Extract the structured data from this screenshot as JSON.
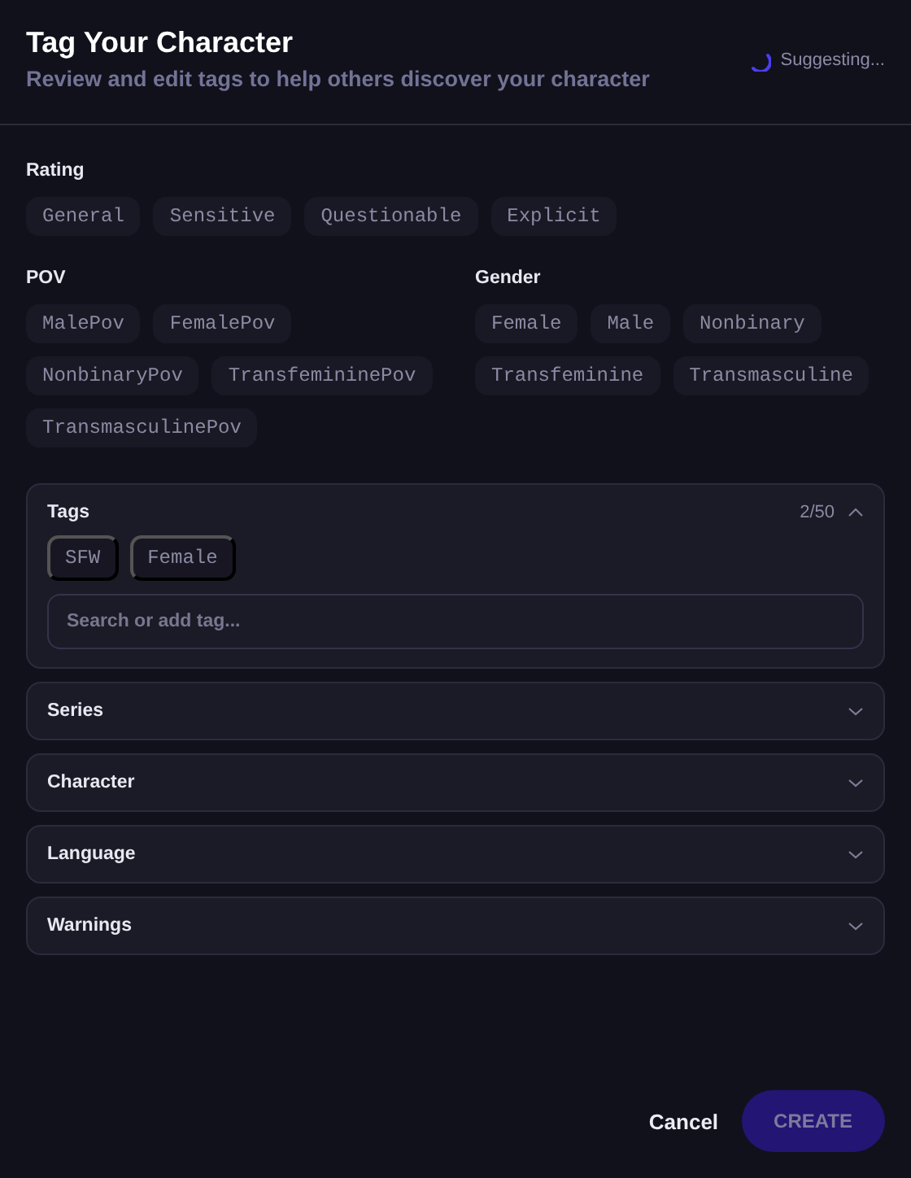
{
  "header": {
    "title": "Tag Your Character",
    "subtitle": "Review and edit tags to help others discover your character",
    "status": "Suggesting..."
  },
  "groups": [
    {
      "label": "Rating",
      "options": [
        "General",
        "Sensitive",
        "Questionable",
        "Explicit"
      ]
    }
  ],
  "columns": [
    {
      "label": "POV",
      "options": [
        "MalePov",
        "FemalePov",
        "NonbinaryPov",
        "TransfemininePov",
        "TransmasculinePov"
      ]
    },
    {
      "label": "Gender",
      "options": [
        "Female",
        "Male",
        "Nonbinary",
        "Transfeminine",
        "Transmasculine"
      ]
    }
  ],
  "sections": [
    {
      "label": "Tags",
      "expanded": true,
      "count": "2/50",
      "tags": [
        "SFW",
        "Female"
      ],
      "placeholder": "Search or add tag..."
    },
    {
      "label": "Series",
      "expanded": false
    },
    {
      "label": "Character",
      "expanded": false
    },
    {
      "label": "Language",
      "expanded": false
    },
    {
      "label": "Warnings",
      "expanded": false
    }
  ],
  "buttons": {
    "cancel": "Cancel",
    "create": "CREATE",
    "create_disabled": true
  }
}
